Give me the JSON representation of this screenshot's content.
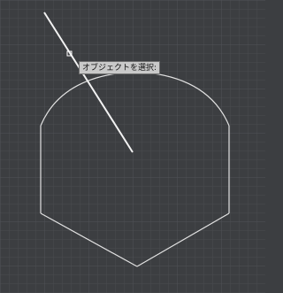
{
  "canvas": {
    "background": "#3c3e41",
    "grid_color": "#4a4c50",
    "major_grid_color": "#505257",
    "shape_stroke": "#e2e2e2",
    "rubberband_stroke": "#f2f2f2",
    "grip_color": "#ffffff"
  },
  "tooltip": {
    "text": "オブジェクトを選択:"
  }
}
